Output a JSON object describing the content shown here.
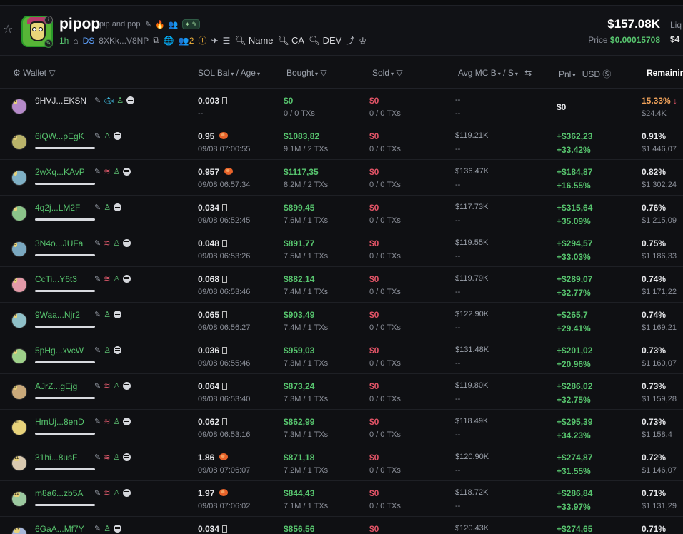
{
  "token": {
    "name": "pipop",
    "full_name": "pip and pop",
    "age": "1h",
    "ds_label": "DS",
    "address": "8XKk...V8NP",
    "holders_count": "2",
    "links": {
      "name": "Name",
      "ca": "CA",
      "dev": "DEV"
    },
    "market_cap": "$157.08K",
    "price_label": "Price",
    "price": "$0.00015708",
    "liq_label": "Liq",
    "liq_value": "$4"
  },
  "table": {
    "headers": {
      "wallet": "Wallet",
      "sol_bal": "SOL Bal",
      "age": "Age",
      "bought": "Bought",
      "sold": "Sold",
      "avg_mc": "Avg MC B",
      "avg_mc_s": "S",
      "pnl": "Pnl",
      "usd": "USD",
      "remaining": "Remaining"
    },
    "rows": [
      {
        "idx": "1",
        "wallet": "9HVJ...EKSN",
        "sol": "0.003",
        "age": "--",
        "bought": "$0",
        "bought_sub": "0 / 0 TXs",
        "sold": "$0",
        "sold_sub": "0 / 0 TXs",
        "mc": "--",
        "mc_sub": "--",
        "pnl": "$0",
        "pnl_pct": "",
        "rem": "15.33%",
        "rem_sub": "$24.4K"
      },
      {
        "idx": "2",
        "wallet": "6iQW...pEgK",
        "sol": "0.95",
        "age": "09/08 07:00:55",
        "bought": "$1083,82",
        "bought_sub": "9.1M / 2 TXs",
        "sold": "$0",
        "sold_sub": "0 / 0 TXs",
        "mc": "$119.21K",
        "mc_sub": "--",
        "pnl": "+$362,23",
        "pnl_pct": "+33.42%",
        "rem": "0.91%",
        "rem_sub": "$1 446,07"
      },
      {
        "idx": "3",
        "wallet": "2wXq...KAvP",
        "sol": "0.957",
        "age": "09/08 06:57:34",
        "bought": "$1117,35",
        "bought_sub": "8.2M / 2 TXs",
        "sold": "$0",
        "sold_sub": "0 / 0 TXs",
        "mc": "$136.47K",
        "mc_sub": "--",
        "pnl": "+$184,87",
        "pnl_pct": "+16.55%",
        "rem": "0.82%",
        "rem_sub": "$1 302,24"
      },
      {
        "idx": "4",
        "wallet": "4q2j...LM2F",
        "sol": "0.034",
        "age": "09/08 06:52:45",
        "bought": "$899,45",
        "bought_sub": "7.6M / 1 TXs",
        "sold": "$0",
        "sold_sub": "0 / 0 TXs",
        "mc": "$117.73K",
        "mc_sub": "--",
        "pnl": "+$315,64",
        "pnl_pct": "+35.09%",
        "rem": "0.76%",
        "rem_sub": "$1 215,09"
      },
      {
        "idx": "5",
        "wallet": "3N4o...JUFa",
        "sol": "0.048",
        "age": "09/08 06:53:26",
        "bought": "$891,77",
        "bought_sub": "7.5M / 1 TXs",
        "sold": "$0",
        "sold_sub": "0 / 0 TXs",
        "mc": "$119.55K",
        "mc_sub": "--",
        "pnl": "+$294,57",
        "pnl_pct": "+33.03%",
        "rem": "0.75%",
        "rem_sub": "$1 186,33"
      },
      {
        "idx": "6",
        "wallet": "CcTi...Y6t3",
        "sol": "0.068",
        "age": "09/08 06:53:46",
        "bought": "$882,14",
        "bought_sub": "7.4M / 1 TXs",
        "sold": "$0",
        "sold_sub": "0 / 0 TXs",
        "mc": "$119.79K",
        "mc_sub": "--",
        "pnl": "+$289,07",
        "pnl_pct": "+32.77%",
        "rem": "0.74%",
        "rem_sub": "$1 171,22"
      },
      {
        "idx": "7",
        "wallet": "9Waa...Njr2",
        "sol": "0.065",
        "age": "09/08 06:56:27",
        "bought": "$903,49",
        "bought_sub": "7.4M / 1 TXs",
        "sold": "$0",
        "sold_sub": "0 / 0 TXs",
        "mc": "$122.90K",
        "mc_sub": "--",
        "pnl": "+$265,7",
        "pnl_pct": "+29.41%",
        "rem": "0.74%",
        "rem_sub": "$1 169,21"
      },
      {
        "idx": "8",
        "wallet": "5pHg...xvcW",
        "sol": "0.036",
        "age": "09/08 06:55:46",
        "bought": "$959,03",
        "bought_sub": "7.3M / 1 TXs",
        "sold": "$0",
        "sold_sub": "0 / 0 TXs",
        "mc": "$131.48K",
        "mc_sub": "--",
        "pnl": "+$201,02",
        "pnl_pct": "+20.96%",
        "rem": "0.73%",
        "rem_sub": "$1 160,07"
      },
      {
        "idx": "9",
        "wallet": "AJrZ...gEjg",
        "sol": "0.064",
        "age": "09/08 06:53:40",
        "bought": "$873,24",
        "bought_sub": "7.3M / 1 TXs",
        "sold": "$0",
        "sold_sub": "0 / 0 TXs",
        "mc": "$119.80K",
        "mc_sub": "--",
        "pnl": "+$286,02",
        "pnl_pct": "+32.75%",
        "rem": "0.73%",
        "rem_sub": "$1 159,28"
      },
      {
        "idx": "10",
        "wallet": "HmUj...8enD",
        "sol": "0.062",
        "age": "09/08 06:53:16",
        "bought": "$862,99",
        "bought_sub": "7.3M / 1 TXs",
        "sold": "$0",
        "sold_sub": "0 / 0 TXs",
        "mc": "$118.49K",
        "mc_sub": "--",
        "pnl": "+$295,39",
        "pnl_pct": "+34.23%",
        "rem": "0.73%",
        "rem_sub": "$1 158,4"
      },
      {
        "idx": "11",
        "wallet": "31hi...8usF",
        "sol": "1.86",
        "age": "09/08 07:06:07",
        "bought": "$871,18",
        "bought_sub": "7.2M / 1 TXs",
        "sold": "$0",
        "sold_sub": "0 / 0 TXs",
        "mc": "$120.90K",
        "mc_sub": "--",
        "pnl": "+$274,87",
        "pnl_pct": "+31.55%",
        "rem": "0.72%",
        "rem_sub": "$1 146,07"
      },
      {
        "idx": "12",
        "wallet": "m8a6...zb5A",
        "sol": "1.97",
        "age": "09/08 07:06:02",
        "bought": "$844,43",
        "bought_sub": "7.1M / 1 TXs",
        "sold": "$0",
        "sold_sub": "0 / 0 TXs",
        "mc": "$118.72K",
        "mc_sub": "--",
        "pnl": "+$286,84",
        "pnl_pct": "+33.97%",
        "rem": "0.71%",
        "rem_sub": "$1 131,29"
      },
      {
        "idx": "13",
        "wallet": "6GaA...Mf7Y",
        "sol": "0.034",
        "age": "",
        "bought": "$856,56",
        "bought_sub": "",
        "sold": "$0",
        "sold_sub": "",
        "mc": "$120.43K",
        "mc_sub": "",
        "pnl": "+$274,65",
        "pnl_pct": "",
        "rem": "0.71%",
        "rem_sub": ""
      }
    ]
  },
  "colors": {
    "green": "#57c46e",
    "red": "#e35467",
    "orange": "#f0a25a",
    "bg": "#0f1013"
  }
}
